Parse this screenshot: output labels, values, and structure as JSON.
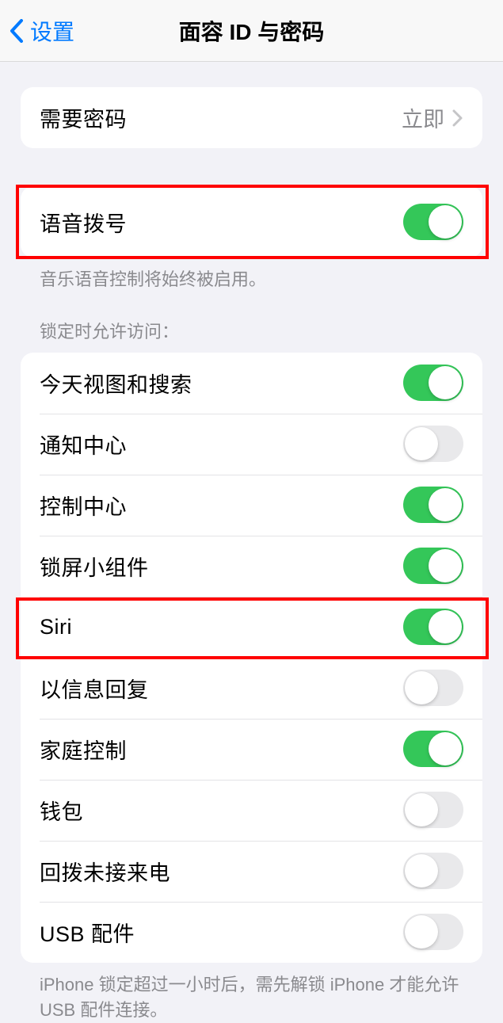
{
  "nav": {
    "back_label": "设置",
    "title": "面容 ID 与密码"
  },
  "require_passcode": {
    "label": "需要密码",
    "value": "立即"
  },
  "voice_dial": {
    "label": "语音拨号",
    "on": true,
    "footer": "音乐语音控制将始终被启用。"
  },
  "lock_access": {
    "header": "锁定时允许访问：",
    "items": [
      {
        "label": "今天视图和搜索",
        "on": true
      },
      {
        "label": "通知中心",
        "on": false
      },
      {
        "label": "控制中心",
        "on": true
      },
      {
        "label": "锁屏小组件",
        "on": true
      },
      {
        "label": "Siri",
        "on": true
      },
      {
        "label": "以信息回复",
        "on": false
      },
      {
        "label": "家庭控制",
        "on": true
      },
      {
        "label": "钱包",
        "on": false
      },
      {
        "label": "回拨未接来电",
        "on": false
      },
      {
        "label": "USB 配件",
        "on": false
      }
    ],
    "footer": "iPhone 锁定超过一小时后，需先解锁 iPhone 才能允许 USB 配件连接。"
  }
}
